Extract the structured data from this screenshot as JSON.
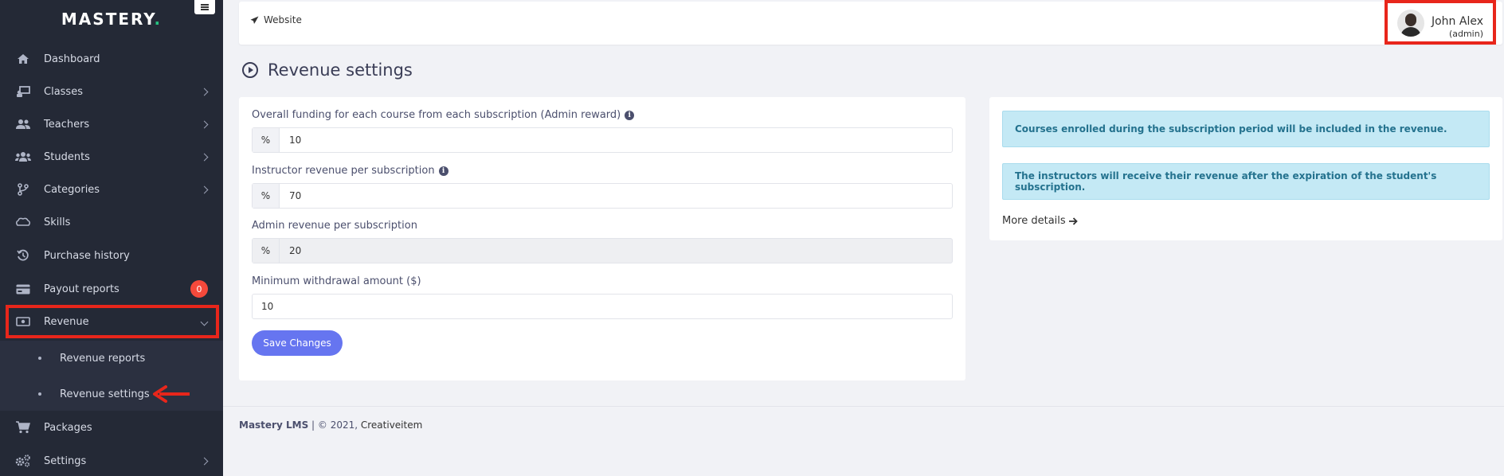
{
  "sidebar": {
    "logo": "MASTERY",
    "logo_dot": ".",
    "items": [
      {
        "label": "Dashboard",
        "icon": "home-icon"
      },
      {
        "label": "Classes",
        "icon": "classes-icon"
      },
      {
        "label": "Teachers",
        "icon": "teachers-icon"
      },
      {
        "label": "Students",
        "icon": "students-icon"
      },
      {
        "label": "Categories",
        "icon": "categories-icon"
      },
      {
        "label": "Skills",
        "icon": "skills-icon"
      },
      {
        "label": "Purchase history",
        "icon": "history-icon"
      },
      {
        "label": "Payout reports",
        "icon": "credit-card-icon",
        "badge": "0"
      },
      {
        "label": "Revenue",
        "icon": "money-icon"
      },
      {
        "label": "Packages",
        "icon": "cart-icon"
      },
      {
        "label": "Settings",
        "icon": "cogs-icon"
      }
    ],
    "submenu": [
      {
        "label": "Revenue reports"
      },
      {
        "label": "Revenue settings"
      }
    ]
  },
  "header": {
    "website_label": "Website",
    "user_name": "John Alex",
    "user_role": "(admin)"
  },
  "page": {
    "title": "Revenue settings"
  },
  "form": {
    "fields": [
      {
        "label": "Overall funding for each course from each subscription (Admin reward)",
        "addon": "%",
        "value": "10"
      },
      {
        "label": "Instructor revenue per subscription",
        "addon": "%",
        "value": "70"
      },
      {
        "label": "Admin revenue per subscription",
        "addon": "%",
        "value": "20"
      },
      {
        "label": "Minimum withdrawal amount ($)",
        "value": "10"
      }
    ],
    "save_label": "Save Changes"
  },
  "info": {
    "alerts": [
      "Courses enrolled during the subscription period will be included in the revenue.",
      "The instructors will receive their revenue after the expiration of the student's subscription."
    ],
    "more_label": "More details"
  },
  "footer": {
    "brand": "Mastery LMS",
    "copyright": " | © 2021, ",
    "company": "Creativeitem"
  },
  "colors": {
    "sidebar_bg": "#242936",
    "accent": "#6675f0",
    "badge": "#f5493b",
    "highlight": "#e8261b",
    "alert_bg": "#c4e9f5"
  }
}
